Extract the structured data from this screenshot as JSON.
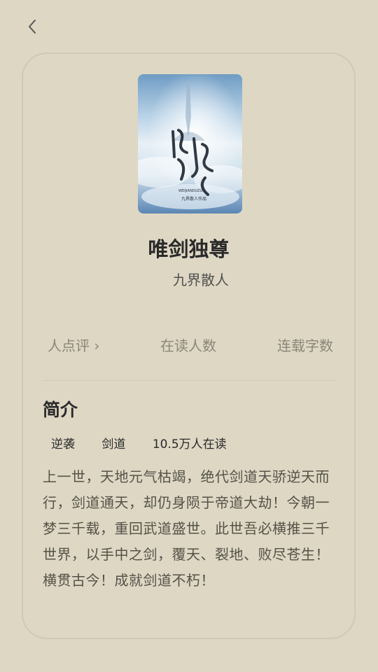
{
  "nav": {
    "back_icon": "chevron-left-icon"
  },
  "book": {
    "title": "唯剑独尊",
    "author": "九界散人",
    "cover_text": {
      "title_art": "唯剑独尊",
      "publisher_line": "九界散人作品"
    }
  },
  "stats": {
    "reviews_label": "人点评",
    "reviews_chevron": "›",
    "reading_label": "在读人数",
    "words_label": "连载字数"
  },
  "intro": {
    "section_title": "简介",
    "tags": [
      "逆袭",
      "剑道",
      "10.5万人在读"
    ],
    "synopsis": "上一世，天地元气枯竭，绝代剑道天骄逆天而行，剑道通天，却仍身陨于帝道大劫！今朝一梦三千载，重回武道盛世。此世吾必横推三千世界，以手中之剑，覆天、裂地、败尽苍生！横贯古今！成就剑道不朽！"
  },
  "colors": {
    "background": "#ddd7c4",
    "card_border": "#d0c9b6",
    "title_text": "#2a2a2a",
    "muted_text": "#8a8677",
    "body_text": "#555247"
  }
}
